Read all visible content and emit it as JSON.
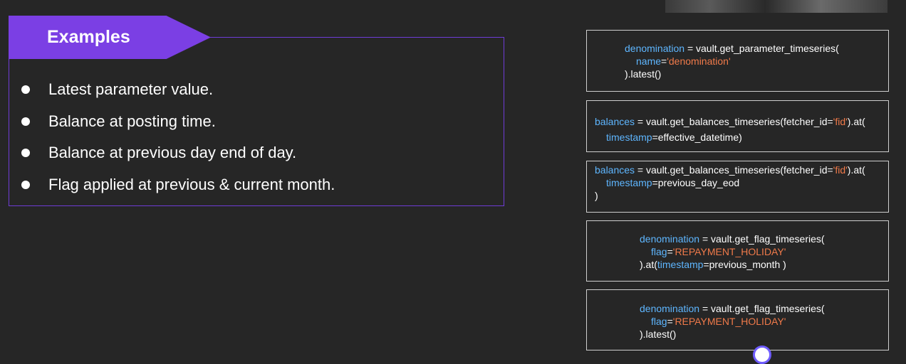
{
  "slide": {
    "title": "Examples",
    "bullets": [
      "Latest parameter value.",
      "Balance at posting time.",
      "Balance at previous day end of day.",
      "Flag applied at previous & current month."
    ]
  },
  "code": {
    "block1": {
      "l1_var": "denomination",
      "l1_rest": " = vault.get_parameter_timeseries(",
      "l2_kw": "name",
      "l2_eq": "=",
      "l2_str": "'denomination'",
      "l3": ").latest()"
    },
    "block2": {
      "l1_var": "balances",
      "l1_mid": " = vault.get_balances_timeseries(fetcher_id=",
      "l1_str": "'fid'",
      "l1_end": ").at(",
      "l2_kw": "timestamp",
      "l2_rest": "=effective_datetime)"
    },
    "block3": {
      "l1_var": "balances",
      "l1_mid": " = vault.get_balances_timeseries(fetcher_id=",
      "l1_str": "'fid'",
      "l1_end": ").at(",
      "l2_kw": "timestamp",
      "l2_rest": "=previous_day_eod",
      "l3": ")"
    },
    "block4": {
      "l1_var": "denomination",
      "l1_rest": " = vault.get_flag_timeseries(",
      "l2_kw": "flag",
      "l2_eq": "=",
      "l2_str": "'REPAYMENT_HOLIDAY'",
      "l3_pre": ").at(",
      "l3_kw": "timestamp",
      "l3_rest": "=previous_month )"
    },
    "block5": {
      "l1_var": "denomination",
      "l1_rest": " = vault.get_flag_timeseries(",
      "l2_kw": "flag",
      "l2_eq": "=",
      "l2_str": "'REPAYMENT_HOLIDAY'",
      "l3": ").latest()"
    }
  },
  "colors": {
    "background": "#262626",
    "accent": "#7b3fe4",
    "keyword": "#5eb6ff",
    "string": "#f07a4a"
  }
}
